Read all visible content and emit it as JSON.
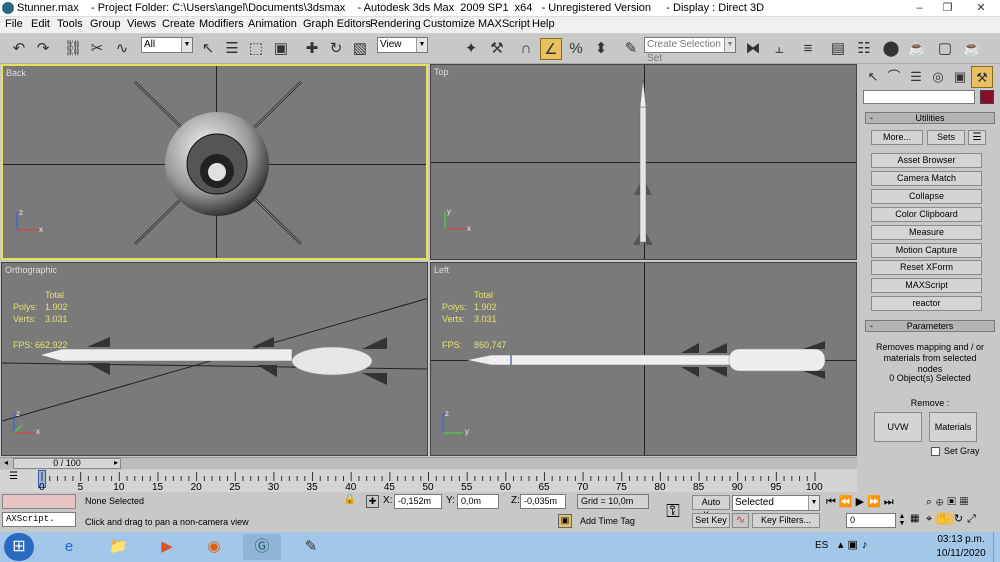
{
  "title_bar": {
    "title": "Stunner.max    - Project Folder: C:\\Users\\angel\\Documents\\3dsmax    - Autodesk 3ds Max  2009 SP1  x64   - Unregistered Version     - Display : Direct 3D"
  },
  "menu": [
    "File",
    "Edit",
    "Tools",
    "Group",
    "Views",
    "Create",
    "Modifiers",
    "Animation",
    "Graph Editors",
    "Rendering",
    "Customize",
    "MAXScript",
    "Help"
  ],
  "toolbar": {
    "filter_select": "All",
    "ref_coord_select": "View",
    "named_selection": "Create Selection Set"
  },
  "viewports": {
    "back": {
      "label": "Back"
    },
    "top": {
      "label": "Top"
    },
    "ortho": {
      "label": "Orthographic",
      "total_label": "Total",
      "polys_label": "Polys:",
      "polys": "1.902",
      "verts_label": "Verts:",
      "verts": "3.031",
      "fps_label": "FPS:",
      "fps": "662,922"
    },
    "left": {
      "label": "Left",
      "total_label": "Total",
      "polys_label": "Polys:",
      "polys": "1.902",
      "verts_label": "Verts:",
      "verts": "3.031",
      "fps_label": "FPS:",
      "fps": "860,747"
    },
    "axis_x": "x",
    "axis_y": "y",
    "axis_z": "z"
  },
  "command_panel": {
    "utilities_header": "Utilities",
    "more_button": "More...",
    "sets_button": "Sets",
    "utilities": [
      "Asset Browser",
      "Camera Match",
      "Collapse",
      "Color Clipboard",
      "Measure",
      "Motion Capture",
      "Reset XForm",
      "MAXScript",
      "reactor"
    ],
    "parameters_header": "Parameters",
    "description": "Removes mapping and / or materials from selected nodes",
    "selection_status": "0 Object(s) Selected",
    "remove_label": "Remove :",
    "uvw_button": "UVW",
    "materials_button": "Materials",
    "set_gray_label": "Set Gray",
    "minus": "-"
  },
  "timeline": {
    "frame_counter": "0 / 100",
    "ticks": [
      "0",
      "5",
      "10",
      "15",
      "20",
      "25",
      "30",
      "35",
      "40",
      "45",
      "50",
      "55",
      "60",
      "65",
      "70",
      "75",
      "80",
      "85",
      "90",
      "95",
      "100"
    ]
  },
  "status": {
    "selection": "None Selected",
    "prompt": "Click and drag to pan a non-camera view",
    "maxscript": "AXScript.",
    "x_label": "X:",
    "x": "-0,152m",
    "y_label": "Y:",
    "y": "0,0m",
    "z_label": "Z:",
    "z": "-0,035m",
    "grid": "Grid = 10,0m",
    "add_time_tag": "Add Time Tag",
    "auto_key": "Auto Key",
    "selected_select": "Selected",
    "set_key": "Set Key",
    "key_filters": "Key Filters...",
    "frame_field": "0"
  },
  "taskbar": {
    "lang": "ES",
    "time": "03:13 p.m.",
    "date": "10/11/2020"
  },
  "colors": {
    "viewport_bg": "#7a7a7a",
    "active_border": "#e6e052",
    "stats_text": "#e7e070",
    "panel_bg": "#c8c8c8",
    "taskbar": "#a3c7e8"
  }
}
